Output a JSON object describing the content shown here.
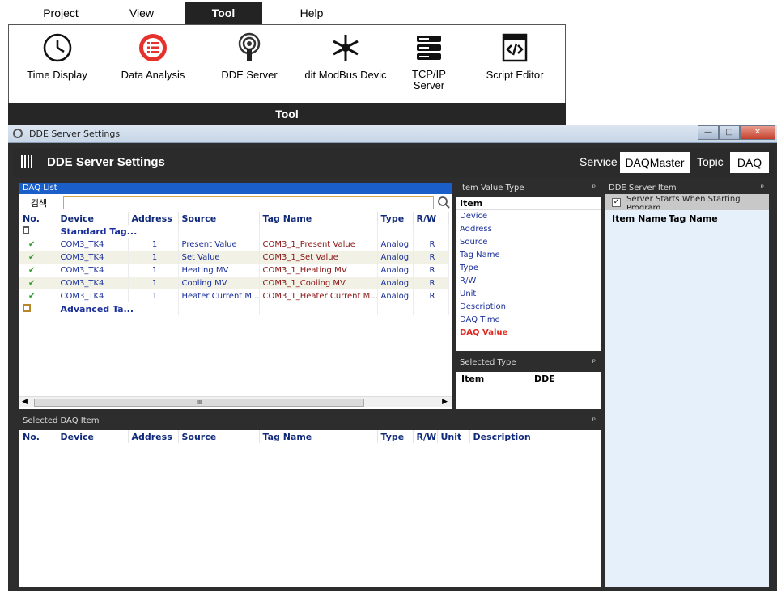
{
  "menu": {
    "items": [
      {
        "label": "Project"
      },
      {
        "label": "View"
      },
      {
        "label": "Tool"
      },
      {
        "label": "Help"
      }
    ]
  },
  "ribbon": {
    "buttons": [
      {
        "label": "Time Display",
        "icon": "clock-icon"
      },
      {
        "label": "Data Analysis",
        "icon": "list-icon"
      },
      {
        "label": "DDE Server",
        "icon": "server-signal-icon"
      },
      {
        "label": "dit ModBus Devic",
        "icon": "network-icon"
      },
      {
        "label": "TCP/IP\nServer",
        "icon": "server-rack-icon"
      },
      {
        "label": "Script Editor",
        "icon": "script-editor-icon"
      }
    ],
    "group_label": "Tool"
  },
  "window": {
    "title": "DDE Server Settings",
    "header_title": "DDE Server Settings",
    "service_label": "Service",
    "service_value": "DAQMaster",
    "topic_label": "Topic",
    "topic_value": "DAQ"
  },
  "daq_list": {
    "panel_title": "DAQ List",
    "search_label": "검색",
    "search_value": "",
    "columns": [
      "No.",
      "Device",
      "Address",
      "Source",
      "Tag Name",
      "Type",
      "R/W"
    ],
    "groups": [
      {
        "label": "Standard Tag..."
      },
      {
        "label": "Advanced Ta..."
      }
    ],
    "rows": [
      {
        "device": "COM3_TK4",
        "address": "1",
        "source": "Present Value",
        "tag": "COM3_1_Present Value",
        "type": "Analog",
        "rw": "R"
      },
      {
        "device": "COM3_TK4",
        "address": "1",
        "source": "Set Value",
        "tag": "COM3_1_Set Value",
        "type": "Analog",
        "rw": "R"
      },
      {
        "device": "COM3_TK4",
        "address": "1",
        "source": "Heating MV",
        "tag": "COM3_1_Heating MV",
        "type": "Analog",
        "rw": "R"
      },
      {
        "device": "COM3_TK4",
        "address": "1",
        "source": "Cooling MV",
        "tag": "COM3_1_Cooling MV",
        "type": "Analog",
        "rw": "R"
      },
      {
        "device": "COM3_TK4",
        "address": "1",
        "source": "Heater Current M...",
        "tag": "COM3_1_Heater Current M...",
        "type": "Analog",
        "rw": "R"
      }
    ]
  },
  "item_value_type": {
    "panel_title": "Item Value Type",
    "header": "Item",
    "items": [
      "Device",
      "Address",
      "Source",
      "Tag Name",
      "Type",
      "R/W",
      "Unit",
      "Description",
      "DAQ Time",
      "DAQ Value"
    ]
  },
  "selected_type": {
    "panel_title": "Selected Type",
    "columns": [
      "Item",
      "DDE"
    ]
  },
  "dde_server_item": {
    "panel_title": "DDE Server Item",
    "checkbox_label": "Server Starts When Starting Program",
    "columns": [
      "Item Name",
      "Tag Name"
    ]
  },
  "selected_daq_item": {
    "panel_title": "Selected DAQ Item",
    "columns": [
      "No.",
      "Device",
      "Address",
      "Source",
      "Tag Name",
      "Type",
      "R/W",
      "Unit",
      "Description"
    ]
  },
  "scroll": {
    "hscroll_mark": "III"
  },
  "pin_glyph": "ᵖ",
  "colors": {
    "dark": "#2d2d2d",
    "accent_blue": "#1a5fc9",
    "panel_blue": "#e6f0fb",
    "error_red": "#e0261c"
  }
}
